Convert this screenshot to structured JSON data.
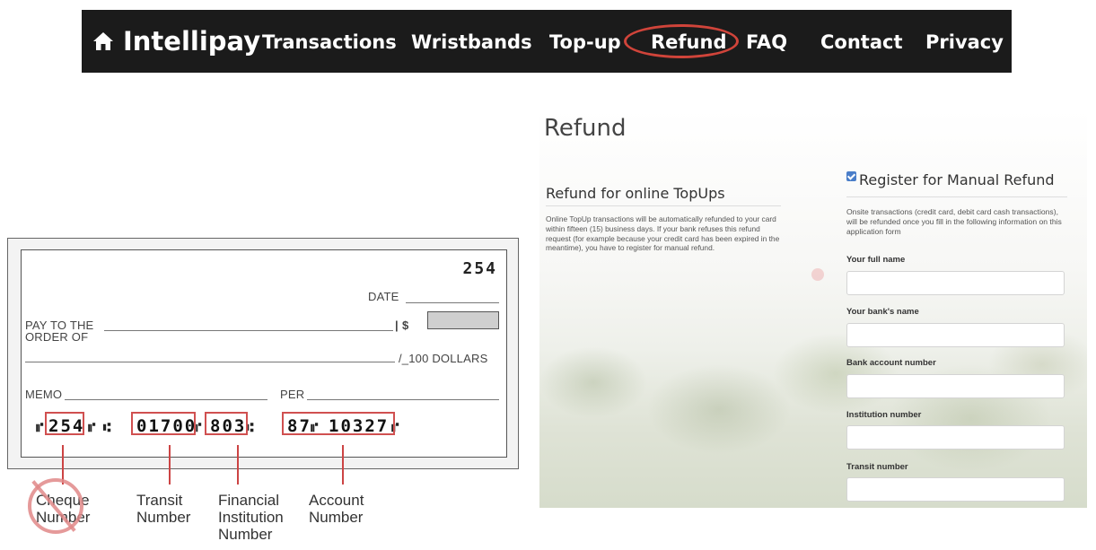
{
  "navbar": {
    "brand": "Intellipay",
    "items": [
      "Transactions",
      "Wristbands",
      "Top-up",
      "Refund",
      "FAQ",
      "Contact",
      "Privacy"
    ],
    "active": "Refund",
    "colors": {
      "background": "#1b1b1b",
      "text": "#ffffff",
      "highlight": "#d0443a"
    }
  },
  "cheque": {
    "number": "254",
    "date_label": "DATE",
    "pay_to_label_1": "PAY TO THE",
    "pay_to_label_2": "ORDER OF",
    "dollar_sign": "$",
    "dollars_label": "/_100 DOLLARS",
    "memo_label": "MEMO",
    "per_label": "PER",
    "micr": {
      "cheque": "254",
      "transit": "01700",
      "institution": "803",
      "account_a": "87",
      "account_b": "10327"
    },
    "annotations": {
      "cheque_number_1": "Cheque",
      "cheque_number_2": "Number",
      "transit_1": "Transit",
      "transit_2": "Number",
      "institution_1": "Financial",
      "institution_2": "Institution",
      "institution_3": "Number",
      "account_1": "Account",
      "account_2": "Number"
    }
  },
  "refund": {
    "title": "Refund",
    "online": {
      "heading": "Refund for online TopUps",
      "body": "Online TopUp transactions will be automatically refunded to your card within fifteen (15) business days. If your bank refuses this refund request (for example because your credit card has been expired in the meantime), you have to register for manual refund."
    },
    "manual": {
      "heading": "Register for Manual Refund",
      "checked": true,
      "body": "Onsite transactions (credit card, debit card cash transactions), will be refunded once you fill in the following information on this application form",
      "fields": [
        {
          "label": "Your full name",
          "value": ""
        },
        {
          "label": "Your bank's name",
          "value": ""
        },
        {
          "label": "Bank account number",
          "value": ""
        },
        {
          "label": "Institution number",
          "value": ""
        },
        {
          "label": "Transit number",
          "value": ""
        }
      ]
    }
  }
}
